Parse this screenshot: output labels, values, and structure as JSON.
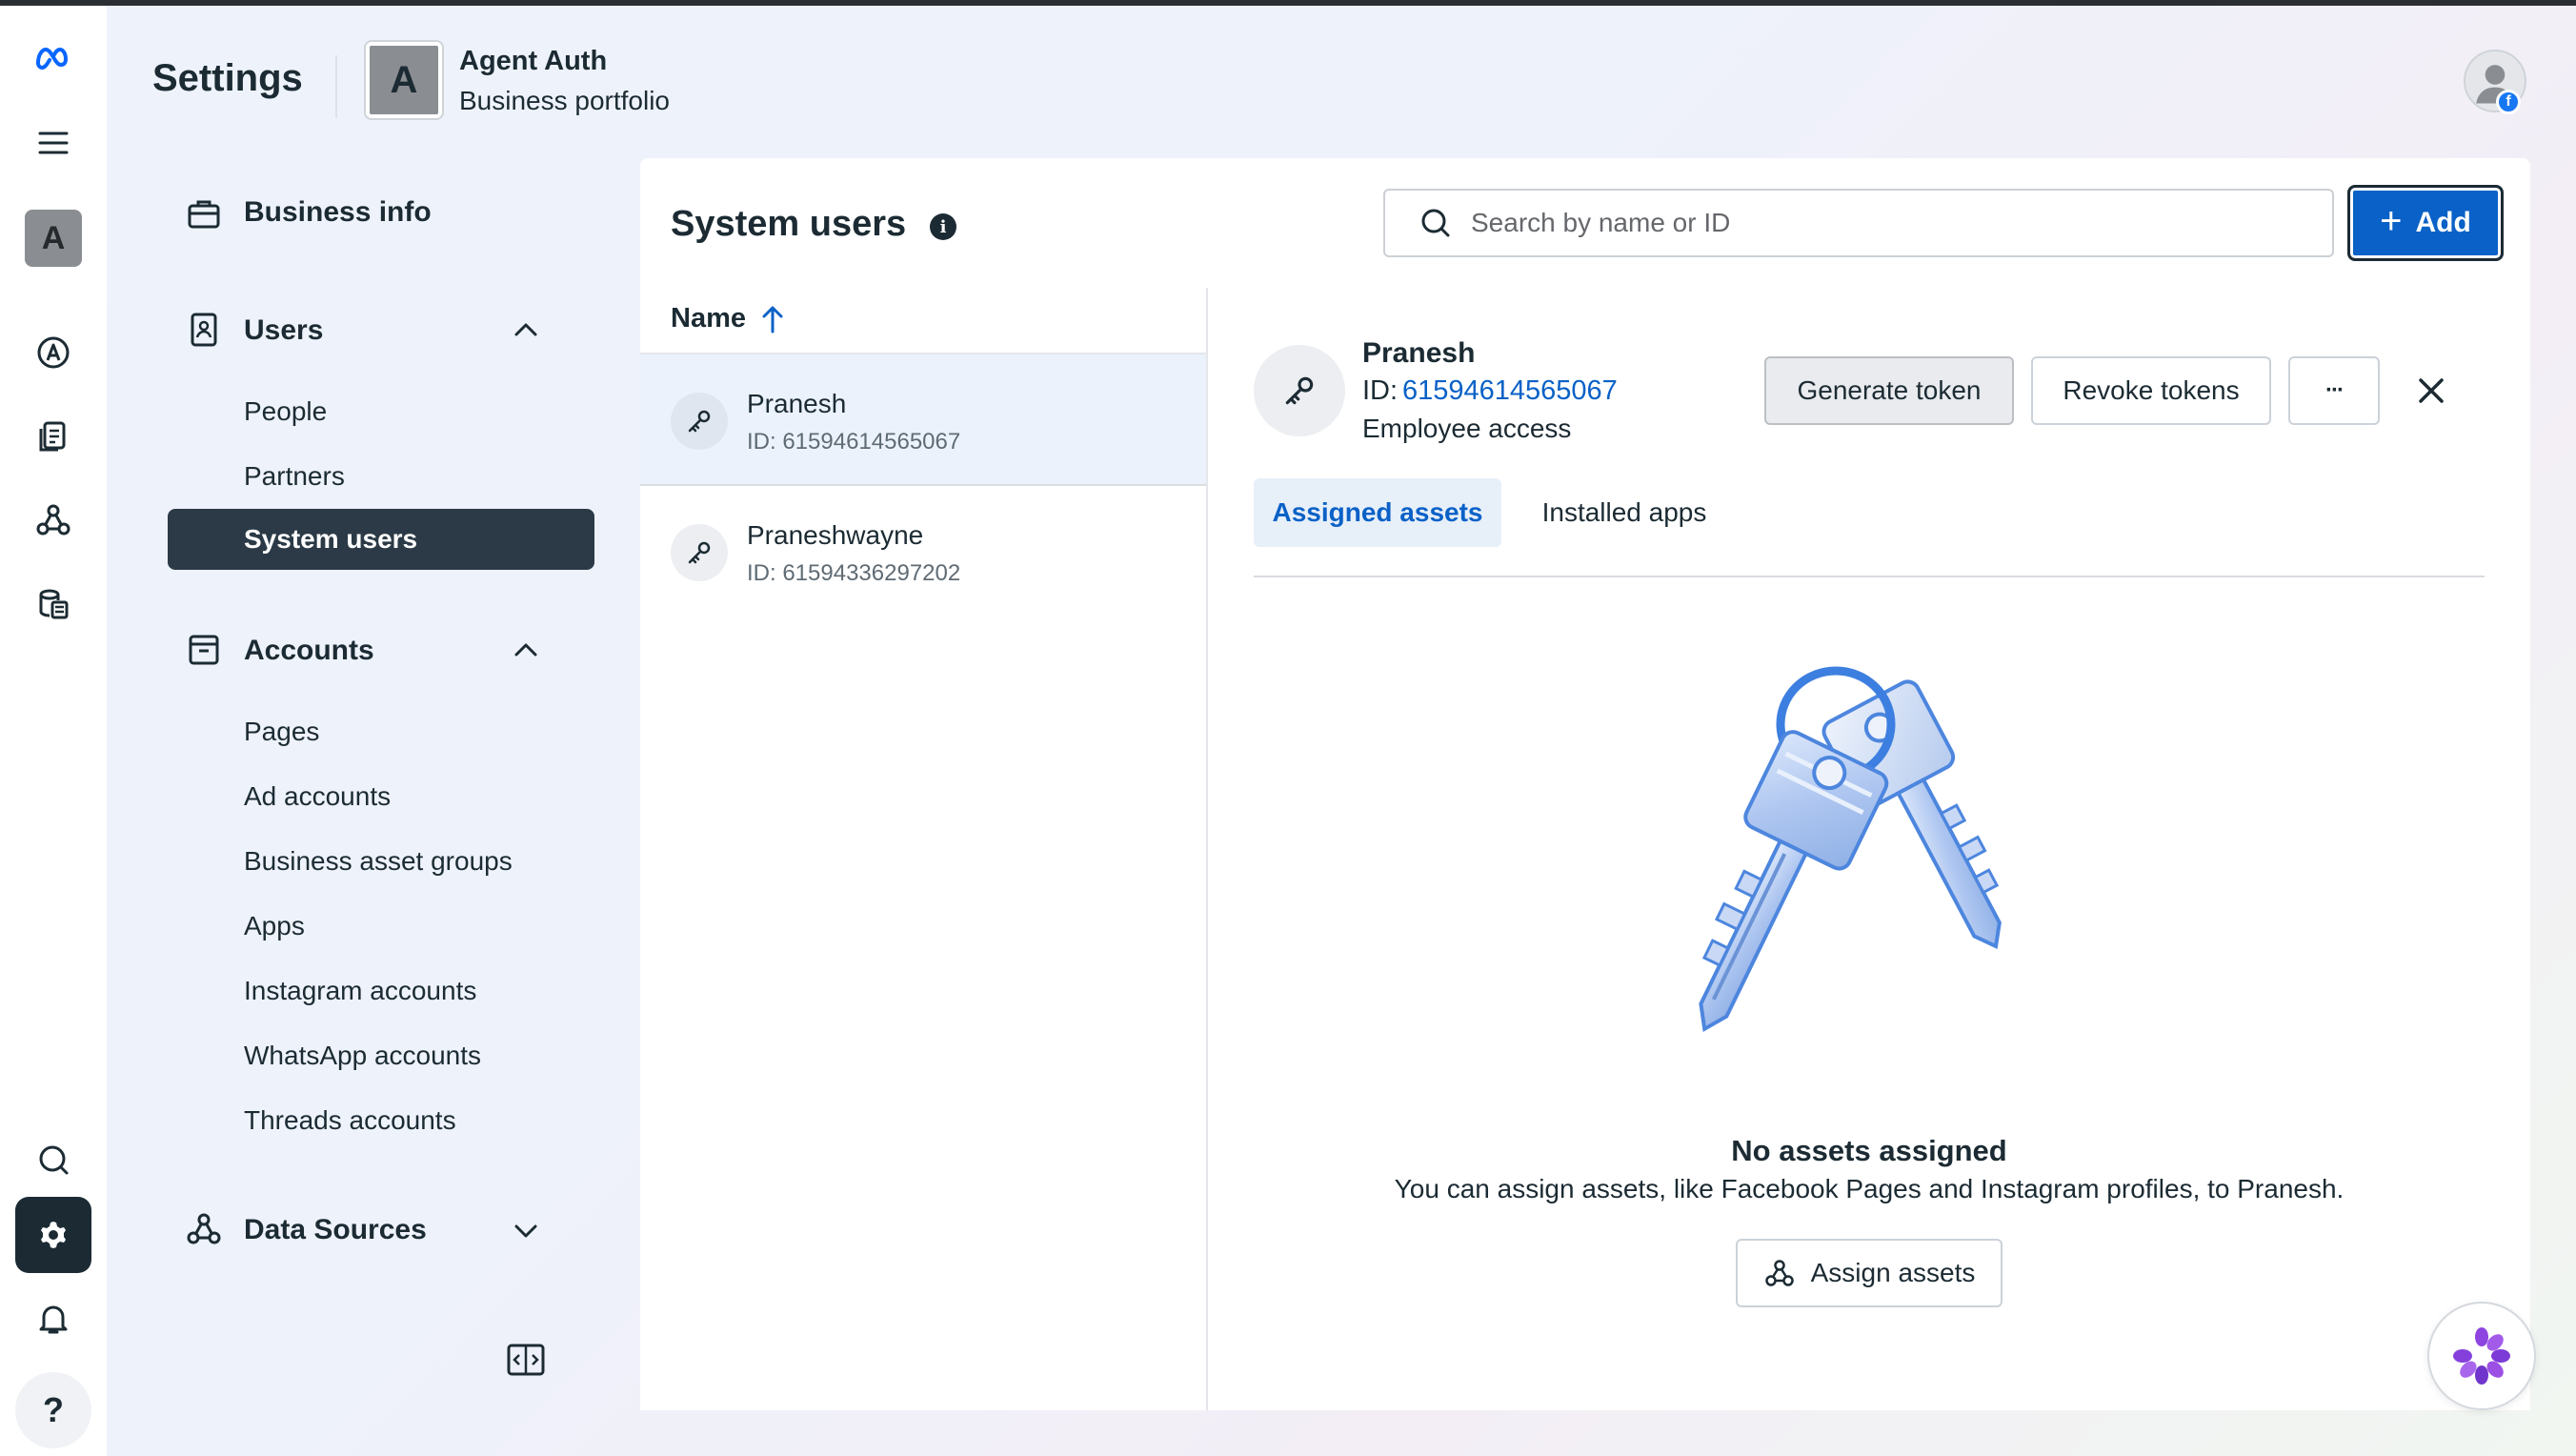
{
  "header": {
    "settings_title": "Settings",
    "portfolio_initial": "A",
    "portfolio_name": "Agent Auth",
    "portfolio_type": "Business portfolio"
  },
  "rail": {
    "avatar_initial": "A",
    "help_label": "?"
  },
  "nav": {
    "business_info": "Business info",
    "users": {
      "label": "Users",
      "items": [
        "People",
        "Partners",
        "System users"
      ],
      "active": "System users"
    },
    "accounts": {
      "label": "Accounts",
      "items": [
        "Pages",
        "Ad accounts",
        "Business asset groups",
        "Apps",
        "Instagram accounts",
        "WhatsApp accounts",
        "Threads accounts"
      ]
    },
    "data_sources": "Data Sources"
  },
  "main": {
    "title": "System users",
    "search_placeholder": "Search by name or ID",
    "add_label": "Add",
    "column_name": "Name",
    "users": [
      {
        "name": "Pranesh",
        "id": "ID: 61594614565067"
      },
      {
        "name": "Praneshwayne",
        "id": "ID: 61594336297202"
      }
    ]
  },
  "detail": {
    "name": "Pranesh",
    "id_label": "ID:",
    "id_value": "61594614565067",
    "access": "Employee access",
    "generate_token": "Generate token",
    "revoke_tokens": "Revoke tokens",
    "more": "···",
    "tabs": [
      "Assigned assets",
      "Installed apps"
    ],
    "empty_title": "No assets assigned",
    "empty_text": "You can assign assets, like Facebook Pages and Instagram profiles, to Pranesh.",
    "assign_label": "Assign assets"
  },
  "colors": {
    "accent": "#0a61c7",
    "nav_active": "#2b3a46",
    "text": "#1c2b33"
  }
}
